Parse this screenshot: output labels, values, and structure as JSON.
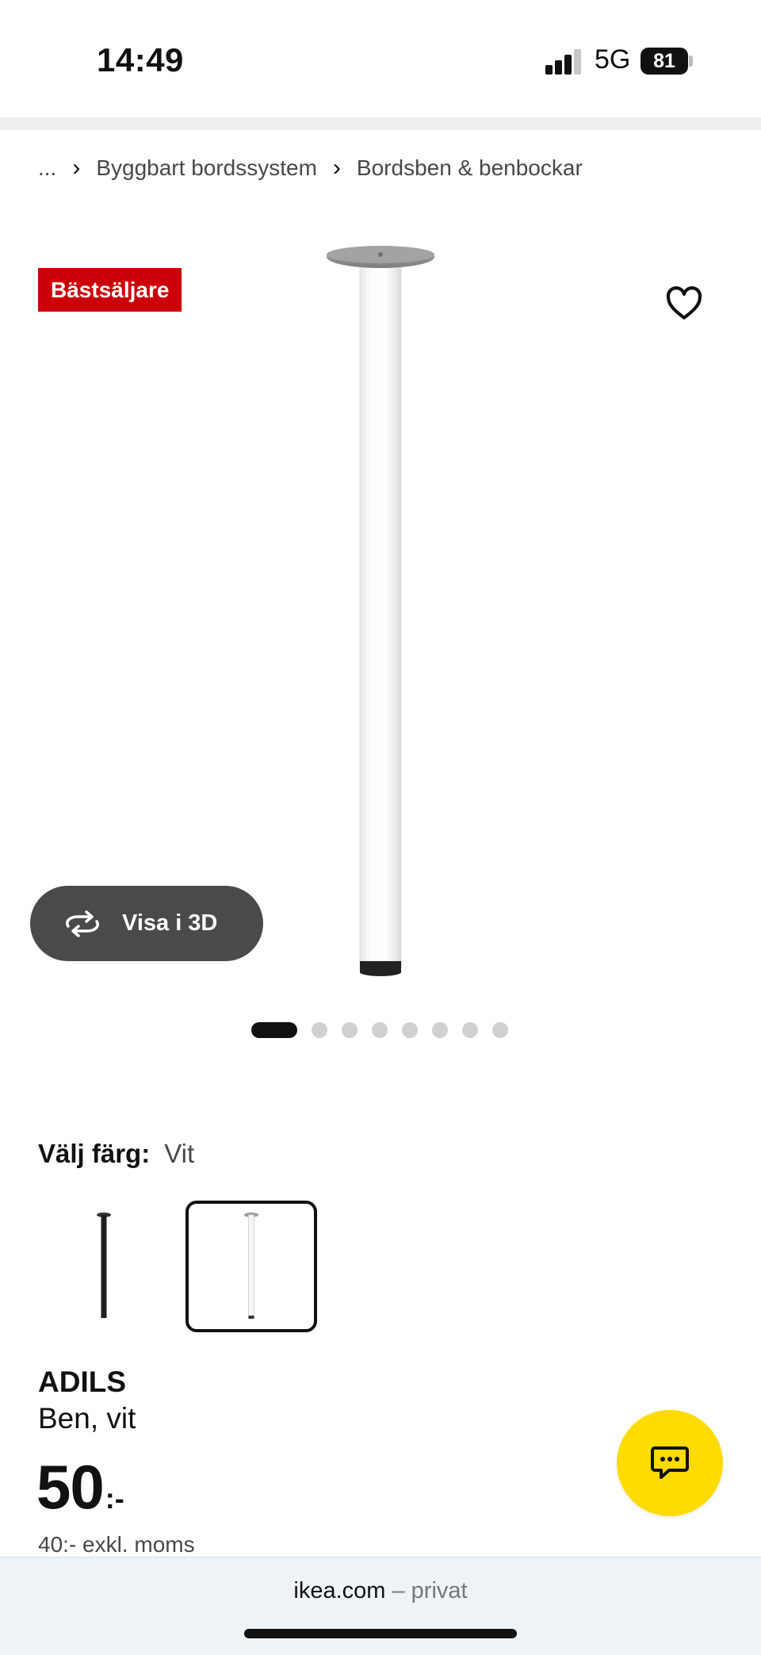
{
  "status_bar": {
    "time": "14:49",
    "network": "5G",
    "battery": "81"
  },
  "breadcrumb": {
    "ellipsis": "...",
    "items": [
      "Byggbart bordssystem",
      "Bordsben & benbockar"
    ]
  },
  "gallery": {
    "badge": "Bästsäljare",
    "view_3d_label": "Visa i 3D",
    "page_count": 8,
    "active_page": 1
  },
  "color_selector": {
    "label": "Välj färg:",
    "selected": "Vit",
    "options": [
      {
        "name": "svart",
        "color": "#1f1f1f",
        "selected": false
      },
      {
        "name": "vit",
        "color": "#f2f2f2",
        "selected": true
      }
    ]
  },
  "product": {
    "name": "ADILS",
    "description": "Ben, vit",
    "price": "50",
    "price_suffix": ":-",
    "price_ex_vat": "40:- exkl. moms"
  },
  "browser": {
    "domain": "ikea.com",
    "mode": " – privat"
  },
  "colors": {
    "badge": "#cc0008",
    "chat_button": "#ffdb00",
    "view3d_button": "#4a4a4a"
  },
  "icons": [
    "heart-icon",
    "rotate-3d-icon",
    "chat-icon",
    "chevron-right-icon"
  ]
}
